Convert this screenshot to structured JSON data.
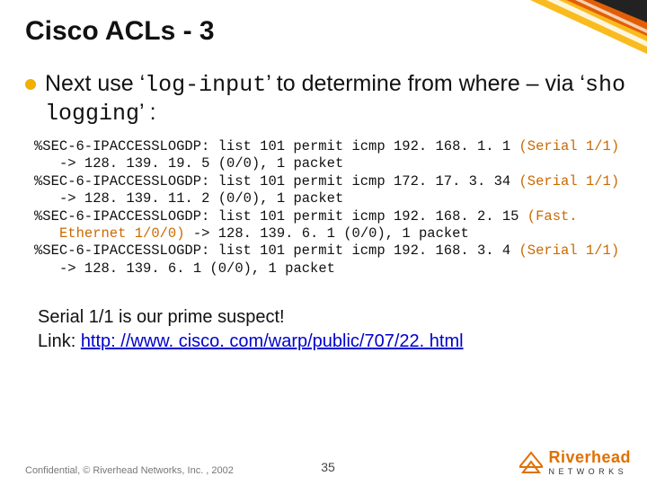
{
  "title": "Cisco ACLs - 3",
  "bullet": {
    "pre": "Next use ‘",
    "cmd1": "log-input",
    "mid": "’ to determine from where – via ‘",
    "cmd2": "sho logging",
    "post": "’ :"
  },
  "logs": [
    {
      "head": "%SEC-6-IPACCESSLOGDP: list 101 permit icmp 192. 168. 1. 1 ",
      "iface": "(Serial 1/1)",
      "tail": " -> 128. 139. 19. 5 (0/0), 1 packet"
    },
    {
      "head": "%SEC-6-IPACCESSLOGDP: list 101 permit icmp 172. 17. 3. 34 ",
      "iface": "(Serial 1/1)",
      "tail": " -> 128. 139. 11. 2 (0/0), 1 packet"
    },
    {
      "head": "%SEC-6-IPACCESSLOGDP: list 101 permit icmp 192. 168. 2. 15 ",
      "iface": "(Fast. Ethernet 1/0/0)",
      "tail": " -> 128. 139. 6. 1 (0/0), 1 packet"
    },
    {
      "head": "%SEC-6-IPACCESSLOGDP: list 101 permit icmp 192. 168. 3. 4 ",
      "iface": "(Serial 1/1)",
      "tail": " -> 128. 139. 6. 1  (0/0), 1 packet"
    }
  ],
  "conclusion": {
    "line1": "Serial 1/1 is our prime suspect!",
    "line2_label": "Link: ",
    "line2_url": "http: //www. cisco. com/warp/public/707/22. html"
  },
  "footer": {
    "left": "Confidential, © Riverhead Networks, Inc. , 2002",
    "page": "35",
    "logo_main": "Riverhead",
    "logo_sub": "N E T W O R K S"
  }
}
